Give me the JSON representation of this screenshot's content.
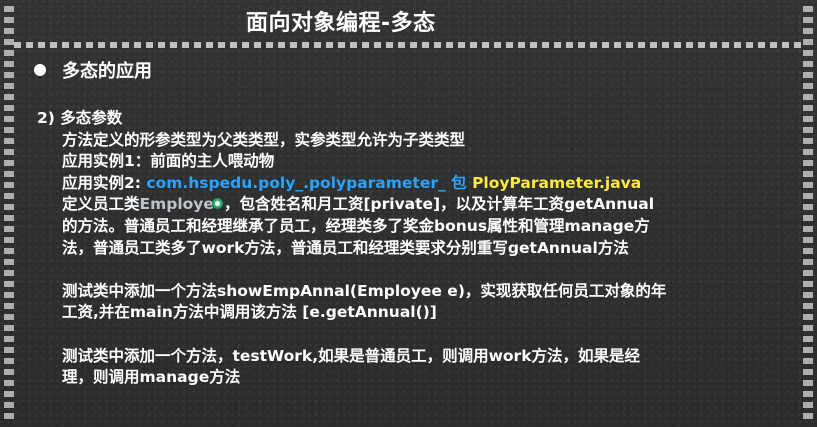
{
  "title": "面向对象编程-多态",
  "bullet": {
    "text": "多态的应用"
  },
  "section": {
    "heading": "2) 多态参数",
    "desc": "方法定义的形参类型为父类类型，实参类型允许为子类类型",
    "example1": "应用实例1：前面的主人喂动物",
    "example2": {
      "label": "应用实例2:",
      "package": "com.hspedu.poly_.polyparameter_ 包",
      "file": "PloyParameter.java"
    },
    "define": {
      "prefix": "定义员工类",
      "faded": "Employe",
      "cursor_glyph": "e",
      "rest": "，包含姓名和月工资[private]，以及计算年工资getAnnual"
    },
    "define_line2": "的方法。普通员工和经理继承了员工，经理类多了奖金bonus属性和管理manage方",
    "define_line3": "法，普通员工类多了work方法，普通员工和经理类要求分别重写getAnnual方法",
    "test1_line1": "测试类中添加一个方法showEmpAnnal(Employee e)，实现获取任何员工对象的年",
    "test1_line2": "工资,并在main方法中调用该方法 [e.getAnnual()]",
    "test2_line1": "测试类中添加一个方法，testWork,如果是普通员工，则调用work方法，如果是经",
    "test2_line2": "理，则调用manage方法"
  },
  "colors": {
    "background": "#2f3031",
    "text": "#ffffff",
    "package_blue": "#2aa3ff",
    "file_yellow": "#ffe93a"
  }
}
